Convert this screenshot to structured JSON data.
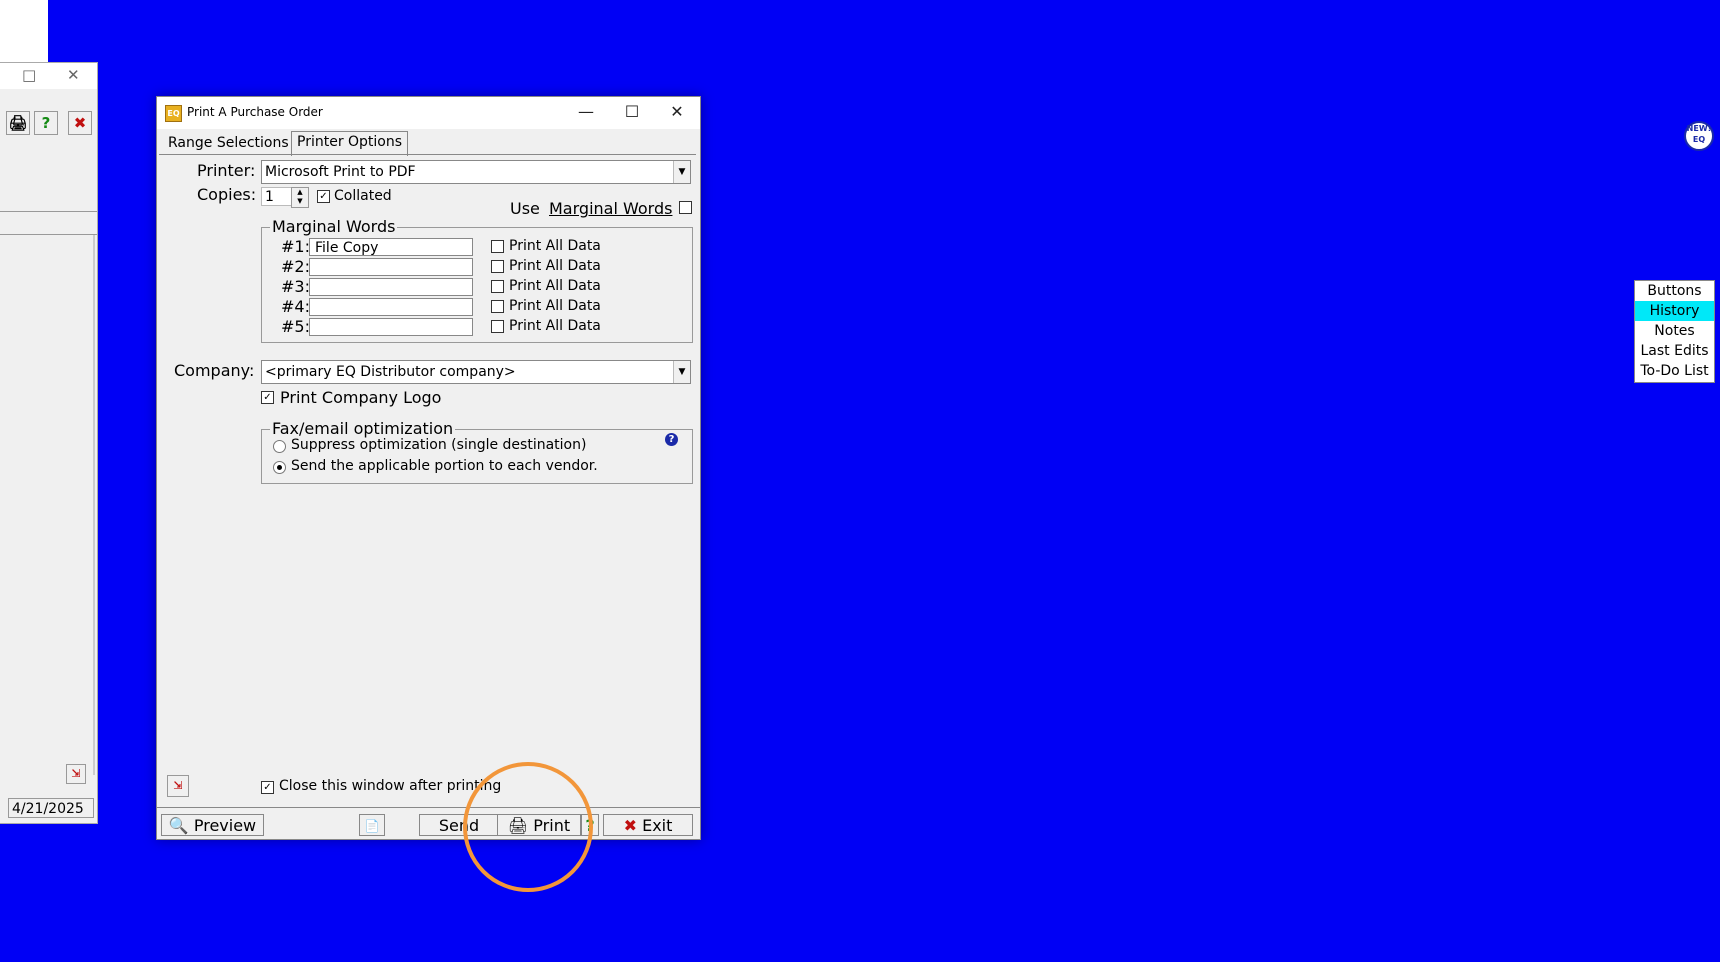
{
  "background_window": {
    "date": "4/21/2025",
    "window_controls": {
      "maximize": "□",
      "close": "✕"
    },
    "toolbar": {
      "print_icon": "printer-icon",
      "help_glyph": "?",
      "close_glyph": "✖"
    }
  },
  "dialog": {
    "title": "Print A Purchase Order",
    "app_icon_text": "EQ",
    "window_controls": {
      "minimize": "—",
      "maximize": "☐",
      "close": "✕"
    },
    "tabs": [
      {
        "label": "Range Selections",
        "active": false
      },
      {
        "label": "Printer Options",
        "active": true
      }
    ],
    "printer": {
      "label": "Printer:",
      "value": "Microsoft Print to PDF"
    },
    "copies": {
      "label": "Copies:",
      "value": "1",
      "collated_label": "Collated",
      "collated_checked": true
    },
    "use_marginal_words": {
      "prefix": "Use",
      "label": "Marginal Words",
      "checked": false
    },
    "marginal_words": {
      "legend": "Marginal Words",
      "print_all_label": "Print All Data",
      "rows": [
        {
          "label": "#1:",
          "value": "File Copy",
          "print_all": false
        },
        {
          "label": "#2:",
          "value": "",
          "print_all": false
        },
        {
          "label": "#3:",
          "value": "",
          "print_all": false
        },
        {
          "label": "#4:",
          "value": "",
          "print_all": false
        },
        {
          "label": "#5:",
          "value": "",
          "print_all": false
        }
      ]
    },
    "company": {
      "label": "Company:",
      "value": "<primary EQ Distributor company>"
    },
    "print_company_logo": {
      "label": "Print Company Logo",
      "checked": true
    },
    "fax_email": {
      "legend": "Fax/email optimization",
      "options": [
        {
          "label": "Suppress optimization (single destination)",
          "selected": false
        },
        {
          "label": "Send the applicable portion to each vendor.",
          "selected": true
        }
      ],
      "help_glyph": "?"
    },
    "close_after_printing": {
      "label": "Close this window after printing",
      "checked": true
    },
    "buttons": {
      "preview": "Preview",
      "send": "Send",
      "print": "Print",
      "help": "?",
      "exit": "Exit"
    }
  },
  "side_panel": {
    "items": [
      {
        "label": "Buttons",
        "active": false
      },
      {
        "label": "History",
        "active": true
      },
      {
        "label": "Notes",
        "active": false
      },
      {
        "label": "Last Edits",
        "active": false
      },
      {
        "label": "To-Do List",
        "active": false
      }
    ]
  },
  "new_badge": {
    "line1": "NEW!",
    "line2": "EQ"
  },
  "colors": {
    "desktop": "#0000f5",
    "highlight_ring": "#f2963a",
    "side_active": "#00e8f8"
  }
}
